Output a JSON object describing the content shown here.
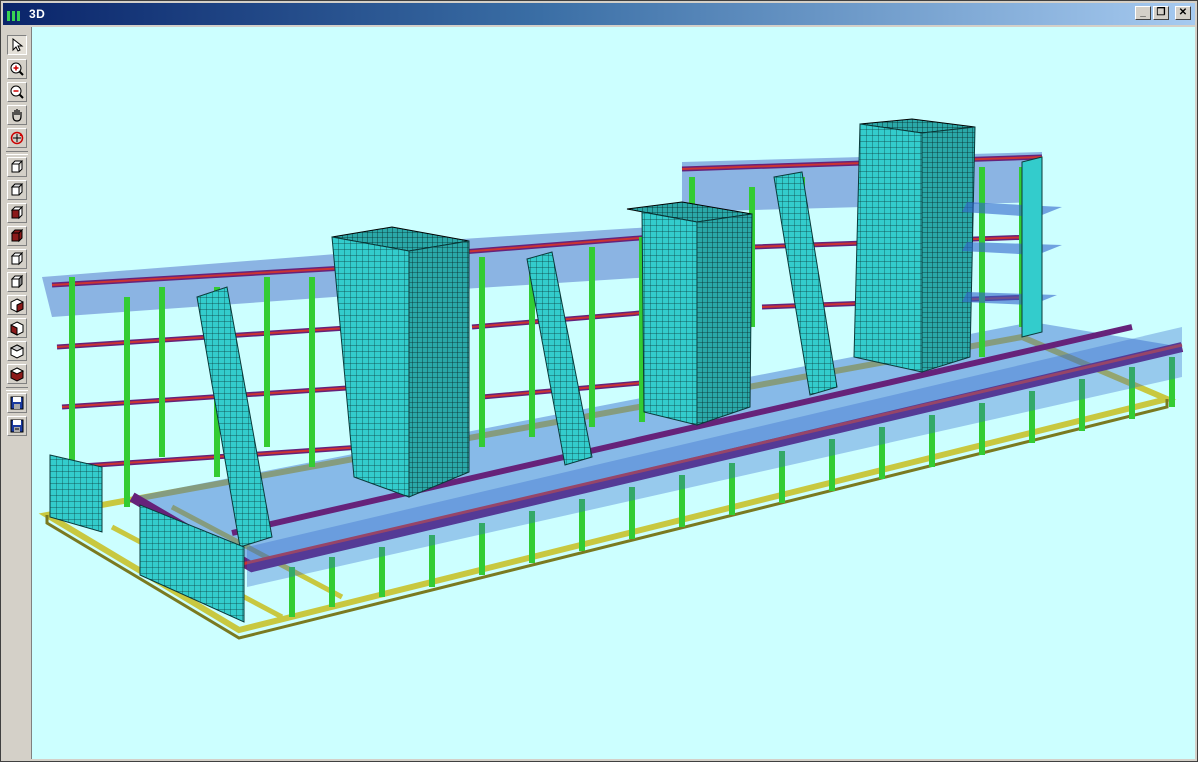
{
  "window": {
    "title": "3D",
    "minimize_glyph": "_",
    "restore_glyph": "❐",
    "close_glyph": "✕"
  },
  "toolbar": {
    "tools": [
      {
        "name": "select-tool",
        "icon": "arrow-pointer-icon"
      },
      {
        "name": "zoom-in-tool",
        "icon": "zoom-in-icon"
      },
      {
        "name": "zoom-out-tool",
        "icon": "zoom-out-icon"
      },
      {
        "name": "pan-tool",
        "icon": "hand-icon"
      },
      {
        "name": "rotate-tool",
        "icon": "rotate-icon"
      },
      {
        "name": "view-iso-1-tool",
        "icon": "cube-icon"
      },
      {
        "name": "view-iso-2-tool",
        "icon": "cube-icon"
      },
      {
        "name": "view-front-tool",
        "icon": "cube-front-icon"
      },
      {
        "name": "view-solid-tool",
        "icon": "cube-solid-icon"
      },
      {
        "name": "view-top-tool",
        "icon": "cube-top-icon"
      },
      {
        "name": "view-left-tool",
        "icon": "cube-left-icon"
      },
      {
        "name": "view-right-tool",
        "icon": "cube-right-icon"
      },
      {
        "name": "view-back-tool",
        "icon": "cube-back-icon"
      },
      {
        "name": "view-bottom-tool",
        "icon": "cube-bottom-icon"
      },
      {
        "name": "view-shaded-tool",
        "icon": "cube-shaded-icon"
      },
      {
        "name": "save-tool",
        "icon": "floppy-disk-icon"
      },
      {
        "name": "save-as-tool",
        "icon": "floppy-disk-icon"
      }
    ]
  },
  "colors": {
    "background": "#ccffff",
    "wall": "#33cccc",
    "column": "#33cc33",
    "beam_edge": "#cc3333",
    "beam": "#66227a",
    "slab": "#3366cc",
    "foundation": "#c8c840"
  }
}
